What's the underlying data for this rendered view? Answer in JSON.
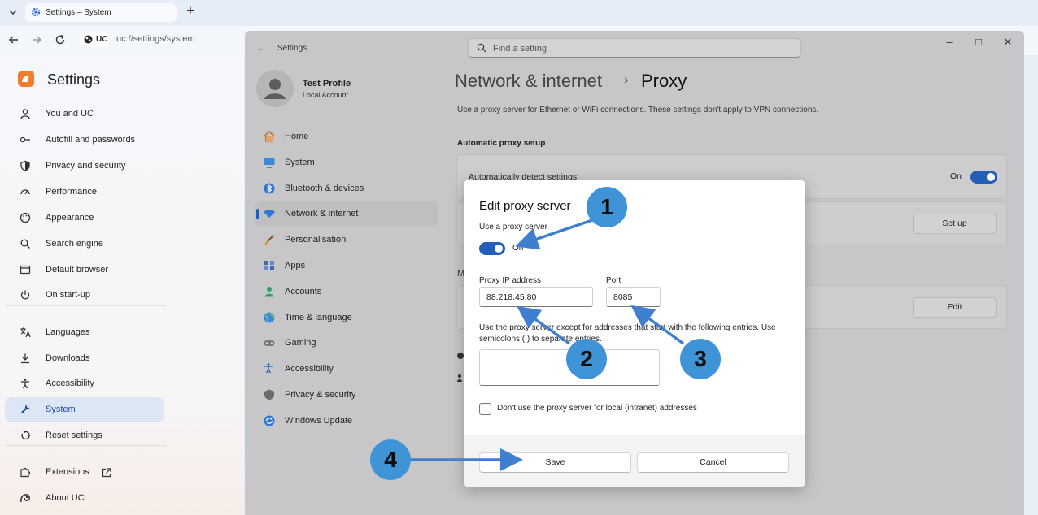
{
  "browser": {
    "tab": {
      "title": "Settings – System",
      "icon": "gear-icon"
    },
    "new_tab_label": "+",
    "address": {
      "site_label": "UC",
      "url": "uc://settings/system"
    }
  },
  "sidebar": {
    "title": "Settings",
    "groups": [
      [
        {
          "label": "You and UC",
          "icon": "person-icon"
        },
        {
          "label": "Autofill and passwords",
          "icon": "key-icon"
        },
        {
          "label": "Privacy and security",
          "icon": "shield-icon"
        },
        {
          "label": "Performance",
          "icon": "speedometer-icon"
        },
        {
          "label": "Appearance",
          "icon": "palette-icon"
        },
        {
          "label": "Search engine",
          "icon": "search-icon"
        },
        {
          "label": "Default browser",
          "icon": "browser-window-icon"
        },
        {
          "label": "On start-up",
          "icon": "power-icon"
        }
      ],
      [
        {
          "label": "Languages",
          "icon": "translate-icon"
        },
        {
          "label": "Downloads",
          "icon": "download-icon"
        },
        {
          "label": "Accessibility",
          "icon": "accessibility-icon"
        },
        {
          "label": "System",
          "icon": "wrench-icon",
          "active": true
        },
        {
          "label": "Reset settings",
          "icon": "reset-icon"
        }
      ],
      [
        {
          "label": "Extensions",
          "icon": "puzzle-icon"
        },
        {
          "label": "About UC",
          "icon": "uc-logo-icon"
        }
      ]
    ]
  },
  "win": {
    "app_title": "Settings",
    "search_placeholder": "Find a setting",
    "profile": {
      "name": "Test Profile",
      "subtitle": "Local Account"
    },
    "nav": [
      {
        "label": "Home",
        "icon": "home-icon"
      },
      {
        "label": "System",
        "icon": "monitor-icon"
      },
      {
        "label": "Bluetooth & devices",
        "icon": "bluetooth-icon"
      },
      {
        "label": "Network & internet",
        "icon": "wifi-icon",
        "active": true
      },
      {
        "label": "Personalisation",
        "icon": "brush-icon"
      },
      {
        "label": "Apps",
        "icon": "apps-icon"
      },
      {
        "label": "Accounts",
        "icon": "account-icon"
      },
      {
        "label": "Time & language",
        "icon": "globe-icon"
      },
      {
        "label": "Gaming",
        "icon": "gamepad-icon"
      },
      {
        "label": "Accessibility",
        "icon": "accessibility-icon"
      },
      {
        "label": "Privacy & security",
        "icon": "shield-icon"
      },
      {
        "label": "Windows Update",
        "icon": "update-icon"
      }
    ],
    "breadcrumb": {
      "parent": "Network & internet",
      "sep": "›",
      "current": "Proxy"
    },
    "description": "Use a proxy server for Ethernet or WiFi connections. These settings don't apply to VPN connections.",
    "auto_section": "Automatic proxy setup",
    "auto_detect": {
      "label": "Automatically detect settings",
      "state_text": "On",
      "on": true
    },
    "setup_button": "Set up",
    "manual_section_letter": "M",
    "edit_button": "Edit"
  },
  "dialog": {
    "title": "Edit proxy server",
    "use_proxy_label": "Use a proxy server",
    "use_proxy_state": "On",
    "use_proxy_on": true,
    "ip_label": "Proxy IP address",
    "ip_value": "88.218.45.80",
    "port_label": "Port",
    "port_value": "8085",
    "exceptions_desc": "Use the proxy server except for addresses that start with the following entries. Use semicolons (;) to separate entries.",
    "exceptions_value": "",
    "local_checkbox_label": "Don't use the proxy server for local (intranet) addresses",
    "local_checked": false,
    "save": "Save",
    "cancel": "Cancel"
  },
  "annotations": {
    "markers": [
      "1",
      "2",
      "3",
      "4"
    ],
    "color": "#3f94d8",
    "arrow_color": "#3f7fd0"
  },
  "colors": {
    "accent": "#235fb8",
    "sidebar_active_bg": "#dde6f4",
    "window_dim": "#c7c7c9"
  }
}
